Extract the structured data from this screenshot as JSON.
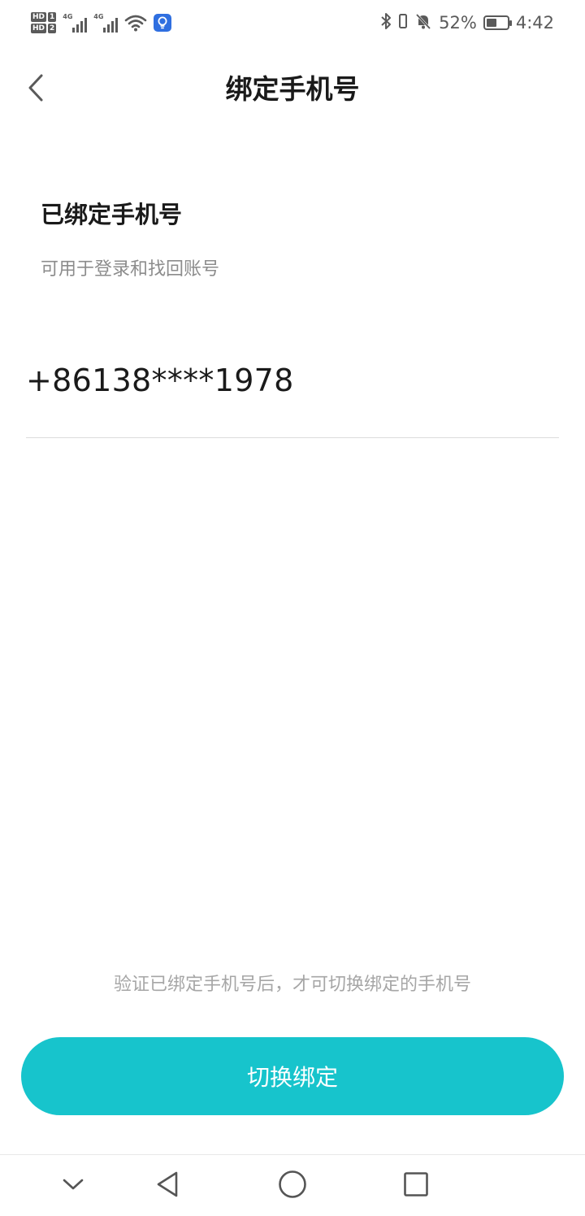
{
  "status_bar": {
    "hd1": "HD",
    "hd1_num": "1",
    "hd2": "HD",
    "hd2_num": "2",
    "sim1_type": "4G",
    "sim2_type": "4G",
    "battery_percent": "52%",
    "battery_level": 0.52,
    "time": "4:42"
  },
  "header": {
    "title": "绑定手机号",
    "back_icon": "chevron-left-icon"
  },
  "section": {
    "title": "已绑定手机号",
    "description": "可用于登录和找回账号"
  },
  "phone": {
    "value": "+86138****1978"
  },
  "hint": {
    "text": "验证已绑定手机号后，才可切换绑定的手机号"
  },
  "action": {
    "switch_label": "切换绑定",
    "accent_color": "#17c4cc"
  },
  "nav": {
    "icons": [
      "chevron-down-icon",
      "triangle-back-icon",
      "circle-home-icon",
      "square-recents-icon"
    ]
  }
}
